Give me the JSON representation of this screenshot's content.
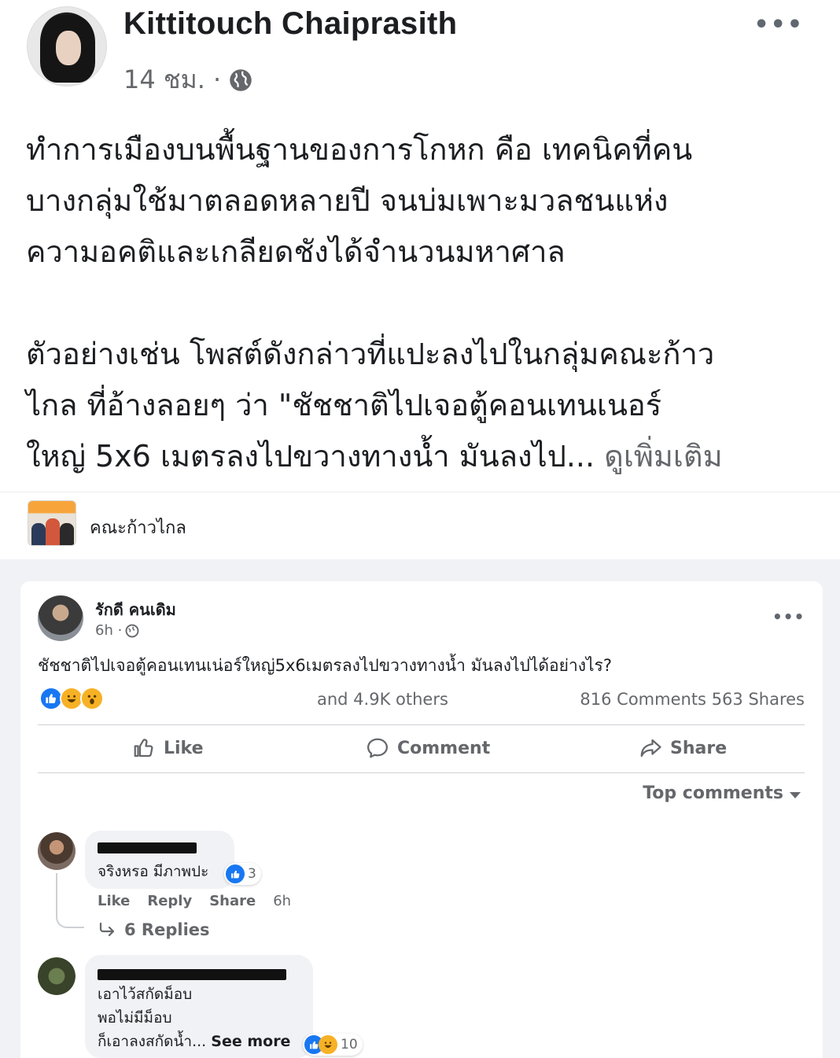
{
  "post": {
    "author": "Kittitouch Chaiprasith",
    "time": "14 ชม. ·",
    "privacy_icon": "globe-icon",
    "more": "•••",
    "text_lines": [
      "ทำการเมืองบนพื้นฐานของการโกหก คือ เทคนิคที่คน",
      "บางกลุ่มใช้มาตลอดหลายปี จนบ่มเพาะมวลชนแห่ง",
      "ความอคติและเกลียดชังได้จำนวนมหาศาล",
      "ตัวอย่างเช่น โพสต์ดังกล่าวที่แปะลงไปในกลุ่มคณะก้าว",
      "ไกล ที่อ้างลอยๆ ว่า \"ชัชชาติไปเจอตู้คอนเทนเนอร์",
      "ใหญ่ 5x6 เมตรลงไปขวางทางน้ำ มันลงไป..."
    ],
    "see_more": "ดูเพิ่มเติม"
  },
  "group": {
    "name": "คณะก้าวไกล"
  },
  "shared": {
    "author": "รักดี คนเดิม",
    "time": "6h ·",
    "more": "•••",
    "text": "ชัชชาติไปเจอตู้คอนเทนเน่อร์ใหญ่5x6เมตรลงไปขวางทางน้ำ มันลงไปได้อย่างไร?",
    "reactions_summary": "and 4.9K others",
    "comments_count": "816 Comments",
    "shares_count": "563 Shares",
    "actions": {
      "like": "Like",
      "comment": "Comment",
      "share": "Share"
    },
    "sort_label": "Top comments",
    "comments": [
      {
        "text": "จริงหรอ มีภาพปะ",
        "reaction_count": "3",
        "like": "Like",
        "reply": "Reply",
        "share": "Share",
        "time": "6h",
        "replies": "6 Replies"
      },
      {
        "lines": [
          "เอาไว้สกัดม็อบ",
          "พอไม่มีม็อบ",
          "ก็เอาลงสกัดน้ำ..."
        ],
        "see_more": "See more",
        "reaction_count": "10"
      }
    ]
  },
  "colors": {
    "accent": "#1877f2",
    "secondary_text": "#65676b",
    "card_bg": "#f0f2f5"
  }
}
